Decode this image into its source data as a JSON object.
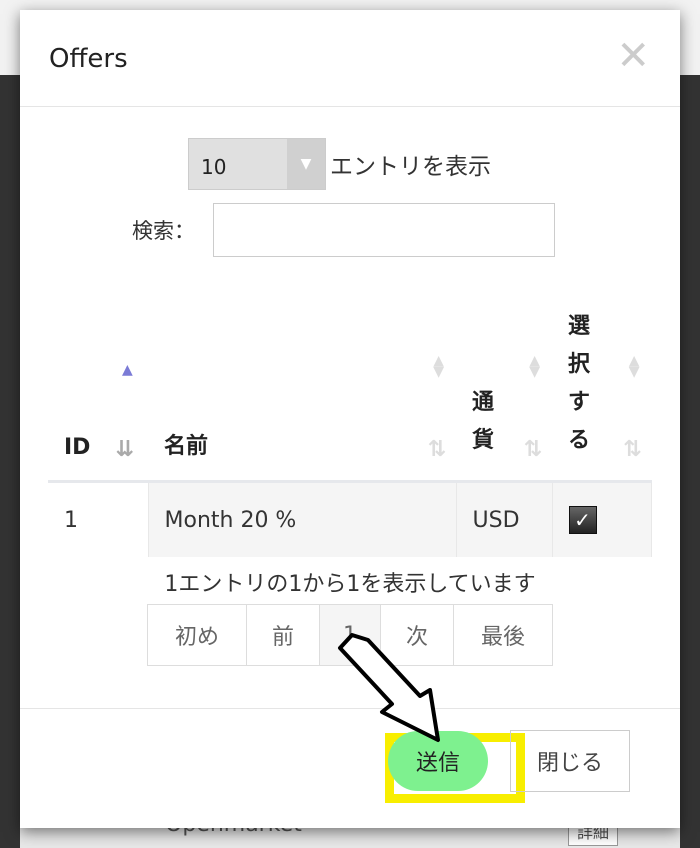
{
  "background": {
    "row_text": "Openmarket",
    "detail_button": "詳細"
  },
  "modal": {
    "title": "Offers",
    "close_icon": "close-icon",
    "length": {
      "value": "10",
      "label": "エントリを表示"
    },
    "search": {
      "label": "検索：",
      "value": "",
      "placeholder": ""
    },
    "columns": [
      {
        "label": "ID",
        "sort": "ascending"
      },
      {
        "label": "名前"
      },
      {
        "label": "通貨"
      },
      {
        "label": "選択する"
      }
    ],
    "rows": [
      {
        "id": "1",
        "name": "Month 20 %",
        "currency": "USD",
        "selected": true
      }
    ],
    "info": "1エントリの1から1を表示しています",
    "pager": {
      "first": "初め",
      "prev": "前",
      "current": "1",
      "next": "次",
      "last": "最後"
    },
    "submit_label": "送信",
    "close_label": "閉じる"
  },
  "colors": {
    "submit": "#7ef18f",
    "highlight": "#f8ee00",
    "sort_active": "#7b7bd6"
  }
}
